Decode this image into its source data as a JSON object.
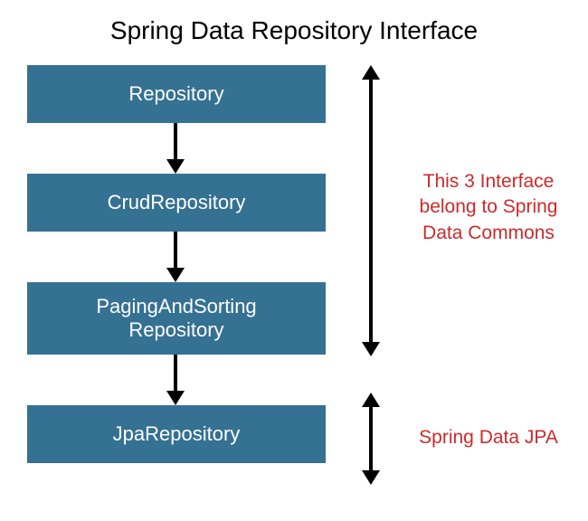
{
  "title": "Spring Data Repository Interface",
  "boxes": {
    "repository": "Repository",
    "crud": "CrudRepository",
    "paging_line1": "PagingAndSorting",
    "paging_line2": "Repository",
    "jpa": "JpaRepository"
  },
  "annotations": {
    "commons_line1": "This 3 Interface",
    "commons_line2": "belong to Spring",
    "commons_line3": "Data Commons",
    "jpa": "Spring Data JPA"
  },
  "colors": {
    "box_bg": "#357193",
    "box_text": "#ffffff",
    "annotation": "#cc2a2a"
  }
}
